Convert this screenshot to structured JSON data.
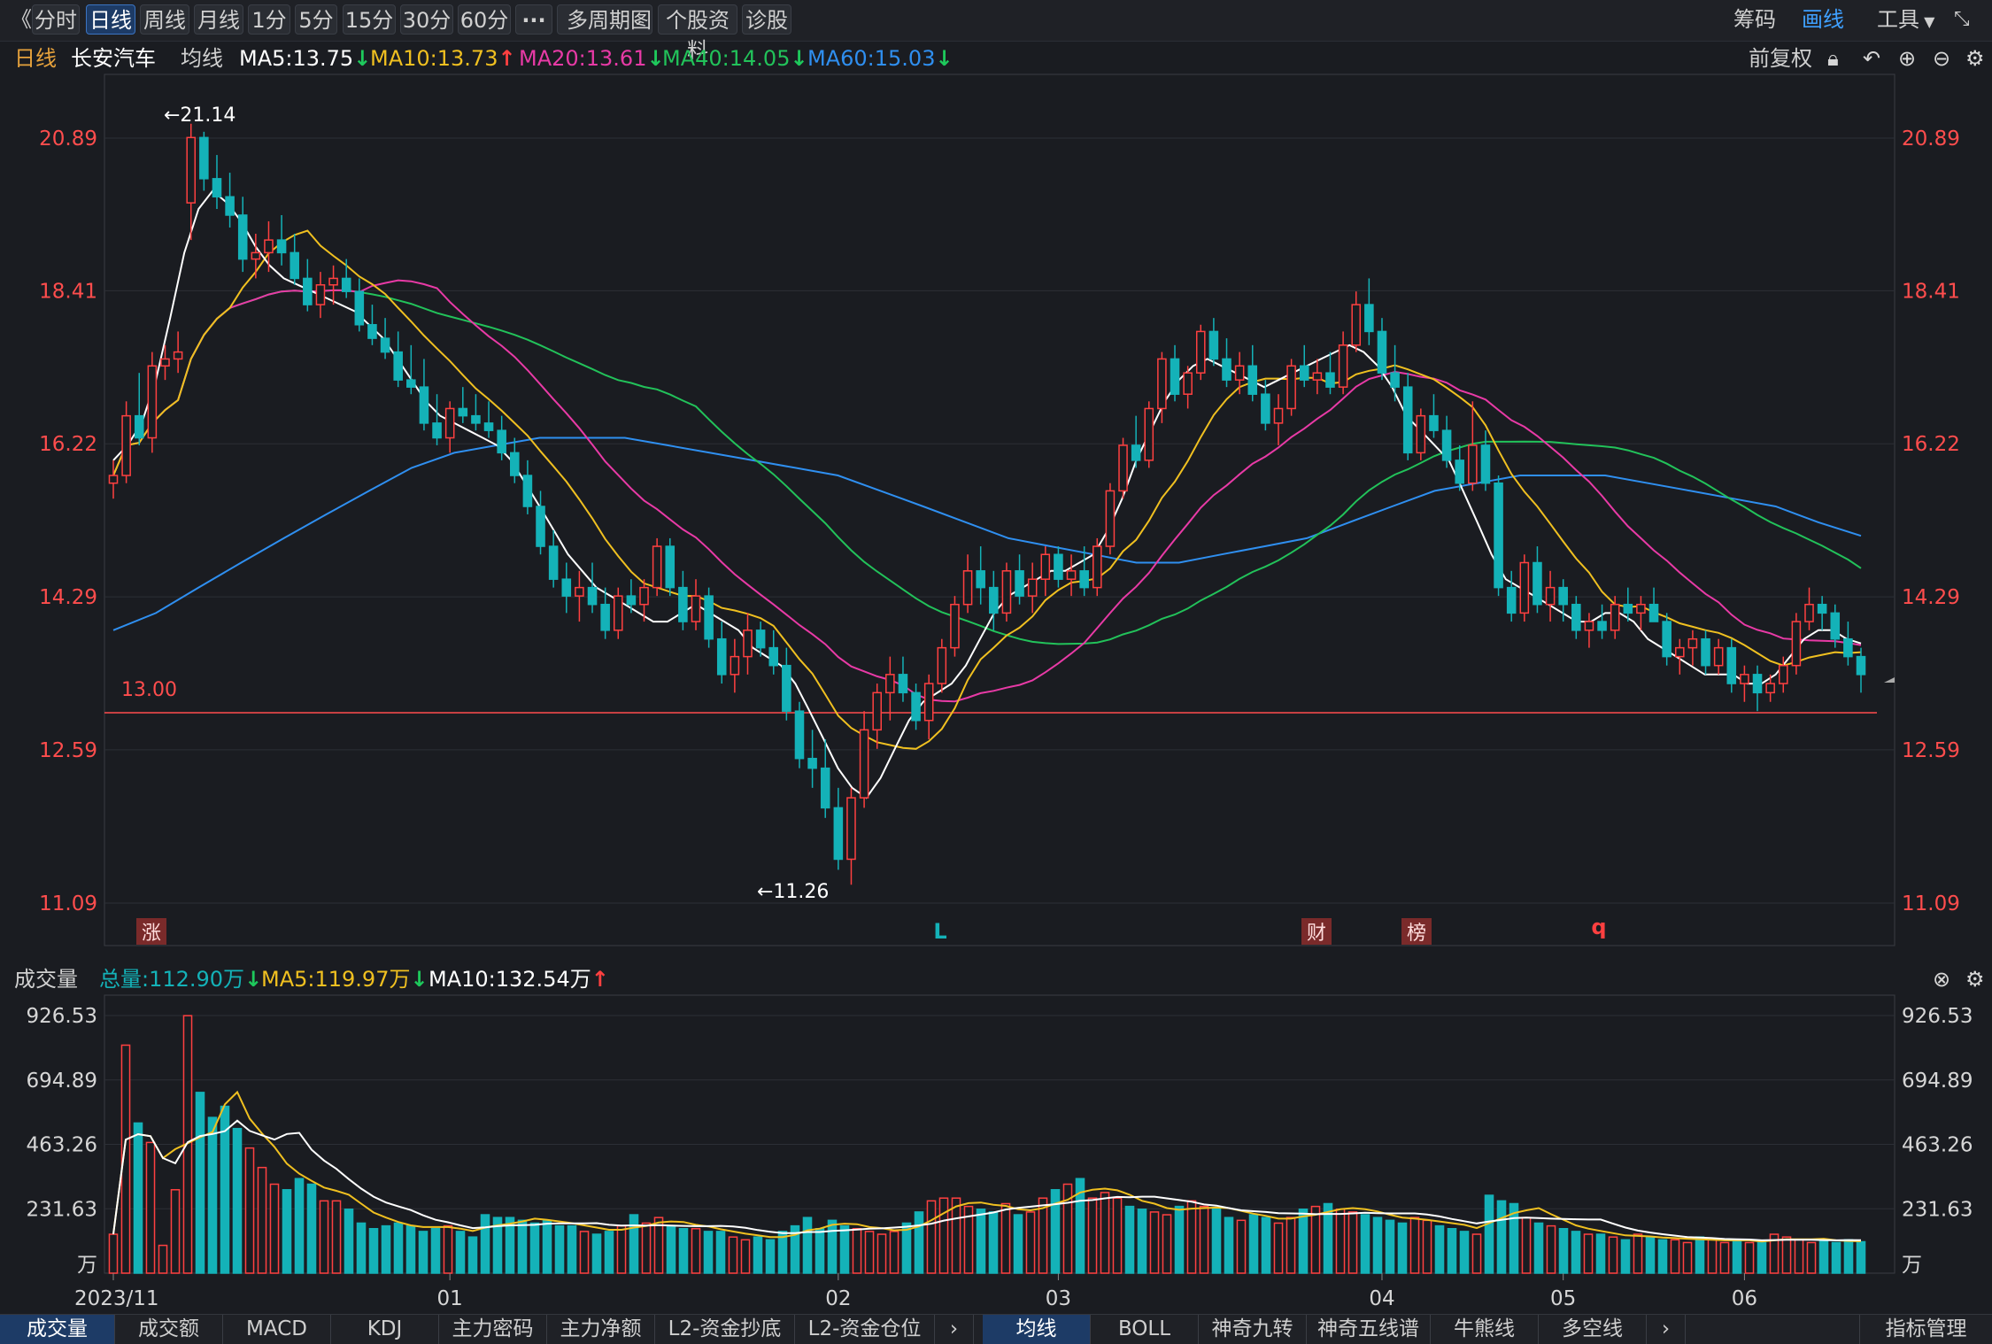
{
  "toolbar": {
    "collapse": "《",
    "periods": [
      "分时",
      "日线",
      "周线",
      "月线",
      "1分",
      "5分",
      "15分",
      "30分",
      "60分"
    ],
    "more": "···",
    "multi": "多周期图",
    "profile": "个股资料",
    "diagnose": "诊股",
    "chips": "筹码",
    "draw": "画线",
    "tools": "工具"
  },
  "info": {
    "period": "日线",
    "stock": "长安汽车",
    "ma_label": "均线",
    "ma5": "MA5:13.75",
    "ma10": "MA10:13.73",
    "ma20": "MA20:13.61",
    "ma40": "MA40:14.05",
    "ma60": "MA60:15.03",
    "adjust": "前复权"
  },
  "price_axis": [
    "20.89",
    "18.41",
    "16.22",
    "14.29",
    "12.59",
    "11.09"
  ],
  "annotations": {
    "high": "←21.14",
    "low": "←11.26",
    "line_value": "13.00",
    "badge_zhang": "涨",
    "mark_l": "L",
    "badge_cai": "财",
    "badge_bang": "榜",
    "mark_q": "q"
  },
  "volume": {
    "title": "成交量",
    "total": "总量:112.90万",
    "ma5": "MA5:119.97万",
    "ma10": "MA10:132.54万",
    "axis": [
      "926.53",
      "694.89",
      "463.26",
      "231.63",
      "万"
    ]
  },
  "dates": [
    "2023/11",
    "01",
    "02",
    "03",
    "04",
    "05",
    "06"
  ],
  "bottom_tabs_left": [
    "成交量",
    "成交额",
    "MACD",
    "KDJ",
    "主力密码",
    "主力净额",
    "L2-资金抄底",
    "L2-资金仓位"
  ],
  "bottom_tabs_right": [
    "均线",
    "BOLL",
    "神奇九转",
    "神奇五线谱",
    "牛熊线",
    "多空线"
  ],
  "bottom_manage": "指标管理",
  "colors": {
    "up": "#ff4040",
    "down": "#14b2b8",
    "ma5": "#ffffff",
    "ma10": "#f0c020",
    "ma20": "#e83aa6",
    "ma40": "#22c25a",
    "ma60": "#2f8ff0"
  },
  "chart_data": {
    "type": "candlestick",
    "price_ylim": [
      11.09,
      20.89
    ],
    "reference_line": 13.0,
    "candles_ohlc": [
      [
        15.7,
        16.0,
        15.5,
        15.8
      ],
      [
        15.8,
        16.8,
        15.7,
        16.6
      ],
      [
        16.6,
        17.2,
        16.2,
        16.3
      ],
      [
        16.3,
        17.5,
        16.1,
        17.3
      ],
      [
        17.3,
        17.6,
        17.1,
        17.4
      ],
      [
        17.4,
        17.8,
        17.2,
        17.5
      ],
      [
        19.8,
        21.14,
        19.2,
        20.9
      ],
      [
        20.9,
        21.0,
        20.0,
        20.2
      ],
      [
        20.2,
        20.6,
        19.7,
        19.9
      ],
      [
        19.9,
        20.3,
        19.4,
        19.6
      ],
      [
        19.6,
        19.9,
        18.7,
        18.9
      ],
      [
        18.9,
        19.3,
        18.6,
        19.0
      ],
      [
        19.0,
        19.5,
        18.7,
        19.2
      ],
      [
        19.2,
        19.6,
        18.8,
        19.0
      ],
      [
        19.0,
        19.3,
        18.5,
        18.6
      ],
      [
        18.6,
        18.9,
        18.1,
        18.2
      ],
      [
        18.2,
        18.7,
        18.0,
        18.5
      ],
      [
        18.5,
        18.8,
        18.2,
        18.6
      ],
      [
        18.6,
        18.9,
        18.3,
        18.4
      ],
      [
        18.4,
        18.6,
        17.8,
        17.9
      ],
      [
        17.9,
        18.2,
        17.6,
        17.7
      ],
      [
        17.7,
        18.0,
        17.4,
        17.5
      ],
      [
        17.5,
        17.8,
        17.0,
        17.1
      ],
      [
        17.1,
        17.6,
        16.9,
        17.0
      ],
      [
        17.0,
        17.4,
        16.4,
        16.5
      ],
      [
        16.5,
        16.9,
        16.2,
        16.3
      ],
      [
        16.3,
        16.8,
        16.1,
        16.7
      ],
      [
        16.7,
        17.0,
        16.5,
        16.6
      ],
      [
        16.6,
        16.9,
        16.4,
        16.5
      ],
      [
        16.5,
        16.8,
        16.3,
        16.4
      ],
      [
        16.4,
        16.6,
        16.0,
        16.1
      ],
      [
        16.1,
        16.3,
        15.7,
        15.8
      ],
      [
        15.8,
        16.0,
        15.3,
        15.4
      ],
      [
        15.4,
        15.6,
        14.8,
        14.9
      ],
      [
        14.9,
        15.1,
        14.4,
        14.5
      ],
      [
        14.5,
        14.7,
        14.1,
        14.3
      ],
      [
        14.3,
        14.6,
        14.0,
        14.4
      ],
      [
        14.4,
        14.7,
        14.1,
        14.2
      ],
      [
        14.2,
        14.4,
        13.8,
        13.9
      ],
      [
        13.9,
        14.4,
        13.8,
        14.3
      ],
      [
        14.3,
        14.5,
        14.1,
        14.2
      ],
      [
        14.2,
        14.5,
        14.0,
        14.4
      ],
      [
        14.4,
        15.0,
        14.3,
        14.9
      ],
      [
        14.9,
        15.0,
        14.3,
        14.4
      ],
      [
        14.4,
        14.6,
        13.9,
        14.0
      ],
      [
        14.0,
        14.5,
        13.9,
        14.3
      ],
      [
        14.3,
        14.4,
        13.7,
        13.8
      ],
      [
        13.8,
        14.0,
        13.3,
        13.4
      ],
      [
        13.4,
        13.8,
        13.2,
        13.6
      ],
      [
        13.6,
        14.1,
        13.4,
        13.9
      ],
      [
        13.9,
        14.0,
        13.6,
        13.7
      ],
      [
        13.7,
        13.9,
        13.4,
        13.5
      ],
      [
        13.5,
        13.7,
        12.9,
        13.0
      ],
      [
        13.0,
        13.1,
        12.4,
        12.5
      ],
      [
        12.5,
        12.8,
        12.2,
        12.4
      ],
      [
        12.4,
        12.7,
        11.9,
        12.0
      ],
      [
        12.0,
        12.2,
        11.4,
        11.5
      ],
      [
        11.5,
        12.2,
        11.26,
        12.1
      ],
      [
        12.1,
        13.0,
        12.0,
        12.8
      ],
      [
        12.8,
        13.3,
        12.6,
        13.2
      ],
      [
        13.2,
        13.6,
        12.9,
        13.4
      ],
      [
        13.4,
        13.6,
        13.1,
        13.2
      ],
      [
        13.2,
        13.3,
        12.8,
        12.9
      ],
      [
        12.9,
        13.4,
        12.7,
        13.3
      ],
      [
        13.3,
        13.8,
        13.2,
        13.7
      ],
      [
        13.7,
        14.3,
        13.6,
        14.2
      ],
      [
        14.2,
        14.8,
        14.1,
        14.6
      ],
      [
        14.6,
        14.9,
        14.2,
        14.4
      ],
      [
        14.4,
        14.6,
        13.9,
        14.1
      ],
      [
        14.1,
        14.7,
        14.0,
        14.6
      ],
      [
        14.6,
        14.8,
        14.2,
        14.3
      ],
      [
        14.3,
        14.7,
        14.1,
        14.5
      ],
      [
        14.5,
        14.9,
        14.3,
        14.8
      ],
      [
        14.8,
        14.9,
        14.4,
        14.5
      ],
      [
        14.5,
        14.8,
        14.3,
        14.6
      ],
      [
        14.6,
        14.9,
        14.3,
        14.4
      ],
      [
        14.4,
        15.0,
        14.3,
        14.9
      ],
      [
        14.9,
        15.7,
        14.8,
        15.6
      ],
      [
        15.6,
        16.3,
        15.5,
        16.2
      ],
      [
        16.2,
        16.6,
        15.9,
        16.0
      ],
      [
        16.0,
        16.8,
        15.9,
        16.7
      ],
      [
        16.7,
        17.5,
        16.5,
        17.4
      ],
      [
        17.4,
        17.6,
        16.8,
        16.9
      ],
      [
        16.9,
        17.3,
        16.7,
        17.2
      ],
      [
        17.2,
        17.9,
        17.1,
        17.8
      ],
      [
        17.8,
        18.0,
        17.3,
        17.4
      ],
      [
        17.4,
        17.7,
        17.0,
        17.1
      ],
      [
        17.1,
        17.5,
        16.9,
        17.3
      ],
      [
        17.3,
        17.6,
        16.8,
        16.9
      ],
      [
        16.9,
        17.1,
        16.4,
        16.5
      ],
      [
        16.5,
        16.9,
        16.2,
        16.7
      ],
      [
        16.7,
        17.4,
        16.6,
        17.3
      ],
      [
        17.3,
        17.6,
        17.0,
        17.1
      ],
      [
        17.1,
        17.4,
        16.9,
        17.2
      ],
      [
        17.2,
        17.5,
        16.9,
        17.0
      ],
      [
        17.0,
        17.8,
        16.9,
        17.6
      ],
      [
        17.6,
        18.4,
        17.5,
        18.2
      ],
      [
        18.2,
        18.6,
        17.6,
        17.8
      ],
      [
        17.8,
        18.0,
        17.1,
        17.2
      ],
      [
        17.2,
        17.6,
        16.8,
        17.0
      ],
      [
        17.0,
        17.2,
        16.0,
        16.1
      ],
      [
        16.1,
        16.7,
        16.0,
        16.6
      ],
      [
        16.6,
        16.9,
        16.3,
        16.4
      ],
      [
        16.4,
        16.6,
        15.9,
        16.0
      ],
      [
        16.0,
        16.2,
        15.6,
        15.7
      ],
      [
        15.7,
        16.8,
        15.6,
        16.2
      ],
      [
        16.2,
        16.4,
        15.6,
        15.7
      ],
      [
        15.7,
        15.8,
        14.3,
        14.4
      ],
      [
        14.4,
        14.6,
        14.0,
        14.1
      ],
      [
        14.1,
        14.8,
        14.0,
        14.7
      ],
      [
        14.7,
        14.9,
        14.1,
        14.2
      ],
      [
        14.2,
        14.6,
        14.0,
        14.4
      ],
      [
        14.4,
        14.5,
        14.0,
        14.2
      ],
      [
        14.2,
        14.3,
        13.8,
        13.9
      ],
      [
        13.9,
        14.1,
        13.7,
        14.0
      ],
      [
        14.0,
        14.2,
        13.8,
        13.9
      ],
      [
        13.9,
        14.3,
        13.8,
        14.2
      ],
      [
        14.2,
        14.4,
        14.0,
        14.1
      ],
      [
        14.1,
        14.3,
        13.9,
        14.2
      ],
      [
        14.2,
        14.4,
        14.0,
        14.0
      ],
      [
        14.0,
        14.1,
        13.5,
        13.6
      ],
      [
        13.6,
        13.8,
        13.4,
        13.7
      ],
      [
        13.7,
        13.9,
        13.5,
        13.8
      ],
      [
        13.8,
        13.9,
        13.4,
        13.5
      ],
      [
        13.5,
        13.8,
        13.4,
        13.7
      ],
      [
        13.7,
        13.8,
        13.2,
        13.3
      ],
      [
        13.3,
        13.5,
        13.1,
        13.4
      ],
      [
        13.4,
        13.5,
        13.0,
        13.2
      ],
      [
        13.2,
        13.4,
        13.1,
        13.3
      ],
      [
        13.3,
        13.6,
        13.2,
        13.5
      ],
      [
        13.5,
        14.1,
        13.4,
        14.0
      ],
      [
        14.0,
        14.4,
        13.9,
        14.2
      ],
      [
        14.2,
        14.3,
        13.9,
        14.1
      ],
      [
        14.1,
        14.2,
        13.7,
        13.8
      ],
      [
        13.8,
        14.0,
        13.5,
        13.6
      ],
      [
        13.6,
        13.7,
        13.2,
        13.4
      ]
    ],
    "volume_ylim": [
      0,
      926.53
    ],
    "volume_values": [
      140,
      820,
      540,
      470,
      100,
      300,
      926,
      650,
      560,
      600,
      520,
      450,
      380,
      320,
      300,
      340,
      320,
      260,
      260,
      230,
      180,
      160,
      170,
      180,
      170,
      150,
      160,
      170,
      150,
      130,
      210,
      200,
      200,
      190,
      180,
      190,
      170,
      170,
      150,
      140,
      150,
      170,
      210,
      180,
      200,
      170,
      160,
      160,
      150,
      150,
      130,
      120,
      130,
      120,
      150,
      170,
      200,
      160,
      190,
      170,
      160,
      150,
      140,
      150,
      180,
      220,
      260,
      270,
      270,
      240,
      230,
      220,
      250,
      210,
      220,
      270,
      300,
      320,
      340,
      270,
      290,
      270,
      240,
      230,
      220,
      210,
      240,
      260,
      240,
      230,
      200,
      190,
      210,
      200,
      180,
      200,
      230,
      240,
      250,
      230,
      220,
      210,
      200,
      190,
      180,
      200,
      190,
      170,
      160,
      150,
      140,
      280,
      260,
      250,
      200,
      180,
      170,
      160,
      150,
      140,
      140,
      130,
      120,
      140,
      130,
      120,
      120,
      110,
      130,
      120,
      110,
      120,
      110,
      110,
      140,
      130,
      120,
      110,
      120,
      110,
      120,
      113
    ],
    "ma5": [
      16.0,
      16.2,
      16.5,
      17.1,
      18.0,
      19.0,
      19.7,
      20.0,
      19.8,
      19.5,
      19.1,
      18.8,
      18.6,
      18.5,
      18.4,
      18.3,
      18.2,
      18.1,
      17.9,
      17.7,
      17.4,
      17.1,
      16.8,
      16.6,
      16.5,
      16.4,
      16.3,
      16.2,
      16.0,
      15.7,
      15.4,
      15.1,
      14.8,
      14.6,
      14.4,
      14.3,
      14.2,
      14.1,
      14.0,
      14.0,
      14.1,
      14.2,
      14.1,
      14.0,
      13.9,
      13.7,
      13.6,
      13.5,
      13.3,
      13.0,
      12.7,
      12.4,
      12.2,
      12.1,
      12.3,
      12.6,
      12.9,
      13.1,
      13.2,
      13.3,
      13.5,
      13.8,
      14.1,
      14.3,
      14.4,
      14.5,
      14.6,
      14.6,
      14.7,
      14.8,
      15.1,
      15.5,
      16.0,
      16.4,
      16.8,
      17.1,
      17.3,
      17.4,
      17.3,
      17.2,
      17.1,
      17.0,
      17.1,
      17.2,
      17.3,
      17.4,
      17.5,
      17.6,
      17.5,
      17.3,
      17.0,
      16.6,
      16.4,
      16.2,
      16.0,
      15.6,
      15.2,
      14.8,
      14.5,
      14.4,
      14.3,
      14.2,
      14.1,
      14.0,
      14.0,
      14.1,
      14.1,
      14.0,
      13.8,
      13.7,
      13.6,
      13.5,
      13.4,
      13.4,
      13.4,
      13.3,
      13.3,
      13.4,
      13.6,
      13.8,
      13.9,
      13.9,
      13.8,
      13.75
    ],
    "ma60": [
      13.9,
      14.1,
      14.4,
      14.7,
      15.0,
      15.3,
      15.6,
      15.9,
      16.1,
      16.2,
      16.3,
      16.3,
      16.3,
      16.2,
      16.1,
      16.0,
      15.9,
      15.8,
      15.6,
      15.4,
      15.2,
      15.0,
      14.9,
      14.8,
      14.7,
      14.7,
      14.8,
      14.9,
      15.0,
      15.2,
      15.4,
      15.6,
      15.7,
      15.8,
      15.8,
      15.8,
      15.7,
      15.6,
      15.5,
      15.4,
      15.2,
      15.03
    ]
  }
}
